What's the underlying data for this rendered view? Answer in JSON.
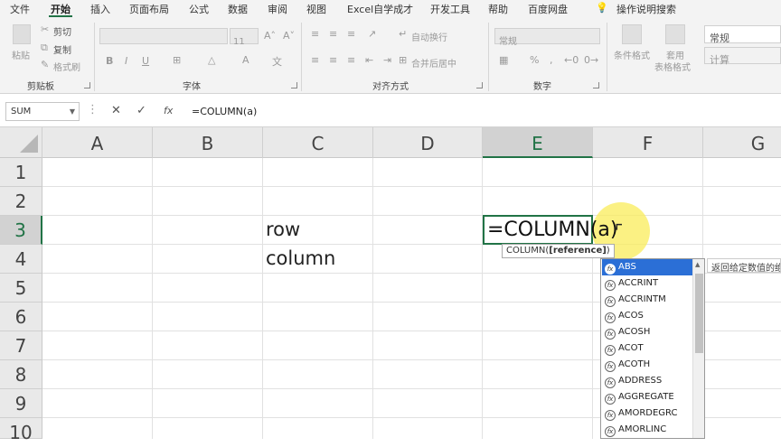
{
  "tabs": [
    "文件",
    "开始",
    "插入",
    "页面布局",
    "公式",
    "数据",
    "审阅",
    "视图",
    "Excel自学成才",
    "开发工具",
    "帮助",
    "百度网盘"
  ],
  "active_tab": "开始",
  "tell_me": "操作说明搜索",
  "ribbon": {
    "clipboard": {
      "paste": "粘贴",
      "cut": "剪切",
      "copy": "复制",
      "format_painter": "格式刷",
      "label": "剪贴板"
    },
    "font": {
      "size": "11",
      "label": "字体",
      "bold": "B",
      "italic": "I",
      "underline": "U"
    },
    "alignment": {
      "wrap": "自动换行",
      "merge": "合并后居中",
      "label": "对齐方式"
    },
    "number": {
      "format": "常规",
      "percent": "%",
      "comma": ",",
      "label": "数字"
    },
    "styles": {
      "conditional": "条件格式",
      "table_line1": "套用",
      "table_line2": "表格格式",
      "normal": "常规",
      "calc": "计算"
    }
  },
  "formula_bar": {
    "name_box": "SUM",
    "cancel": "✕",
    "enter": "✓",
    "fx": "fx",
    "content": "=COLUMN(a)"
  },
  "columns": [
    "A",
    "B",
    "C",
    "D",
    "E",
    "F",
    "G"
  ],
  "rows": [
    "1",
    "2",
    "3",
    "4",
    "5",
    "6",
    "7",
    "8",
    "9",
    "10"
  ],
  "cells": {
    "C3": "row",
    "C4": "column",
    "E3": "=COLUMN(a)"
  },
  "tooltip": {
    "prefix": "COLUMN(",
    "arg": "[reference]",
    "suffix": ")"
  },
  "autocomplete": [
    "ABS",
    "ACCRINT",
    "ACCRINTM",
    "ACOS",
    "ACOSH",
    "ACOT",
    "ACOTH",
    "ADDRESS",
    "AGGREGATE",
    "AMORDEGRC",
    "AMORLINC"
  ],
  "autocomplete_desc": "返回给定数值的绝",
  "colors": {
    "accent": "#217346",
    "selection": "#2b6fd6",
    "highlight": "#faec5a"
  }
}
